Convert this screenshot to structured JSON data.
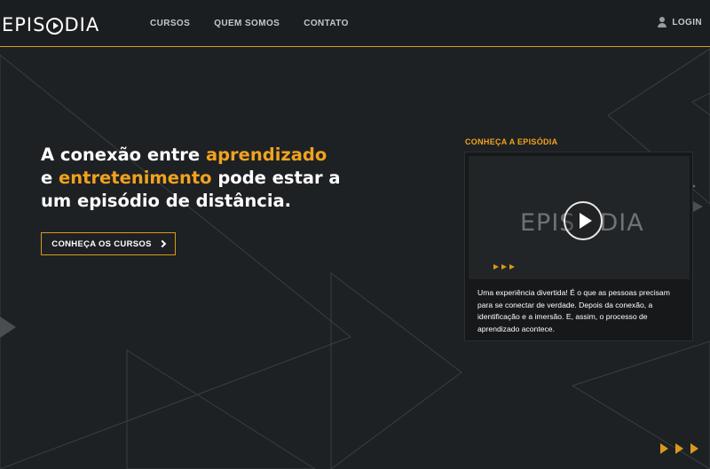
{
  "header": {
    "logo_prefix": "EPIS",
    "logo_suffix": "DIA",
    "nav": [
      "CURSOS",
      "QUEM SOMOS",
      "CONTATO"
    ],
    "login_label": "LOGIN",
    "accent_line_color": "#d99a1b"
  },
  "hero": {
    "line1_plain": "A conexão entre ",
    "line1_accent": "aprendizado",
    "line2_start": "e ",
    "line2_accent": "entretenimento",
    "line2_plain": " pode estar a",
    "line3": "um episódio de distância.",
    "cta_label": "CONHEÇA OS CURSOS",
    "cta_icon": "chevron-right-icon",
    "accent_color": "#f0a21e"
  },
  "video_section": {
    "label": "CONHEÇA A EPISÓDIA",
    "video_logo_prefix": "EPIS",
    "video_logo_suffix": "DIA",
    "play_icon": "play-icon",
    "description": "Uma experiência divertida! É o que as pessoas precisam para se conectar de verdade. Depois da conexão, a identificação e a imersão. E, assim, o processo de aprendizado acontece."
  },
  "colors": {
    "background": "#1e2124",
    "header_background": "#1b1e21",
    "accent": "#f0a21e"
  }
}
